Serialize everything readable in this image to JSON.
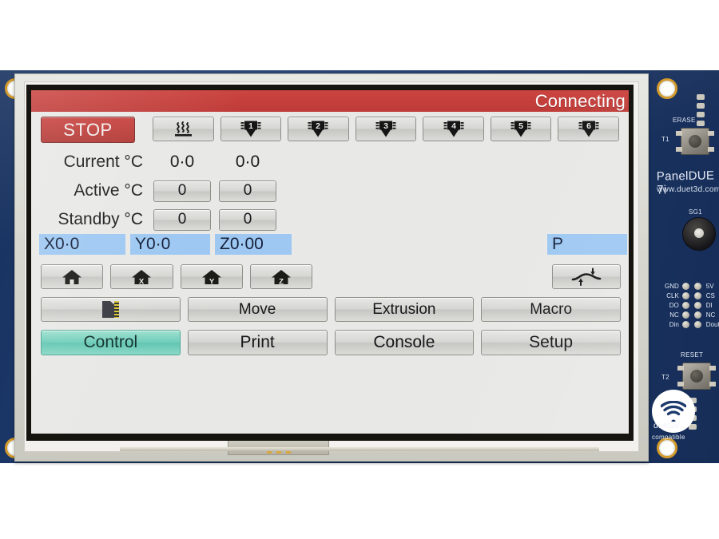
{
  "device": {
    "name": "PanelDUE 7i",
    "vendor_url": "www.duet3d.com",
    "badge_text_1": "duet3d",
    "badge_text_2": "compatible"
  },
  "pcb": {
    "erase_label": "ERASE",
    "erase_ref": "T1",
    "reset_label": "RESET",
    "reset_ref": "T2",
    "buzzer_ref": "SG1",
    "pins_left": [
      "GND",
      "CLK",
      "DO",
      "NC",
      "Din"
    ],
    "pins_right": [
      "5V",
      "CS",
      "DI",
      "NC",
      "Dout"
    ]
  },
  "screen": {
    "titlebar": {
      "status": "Connecting"
    },
    "stop_button": "STOP",
    "tools": [
      {
        "label": "",
        "icon": "heated-bed-icon",
        "number": ""
      },
      {
        "label": "",
        "icon": "tool-icon",
        "number": "1"
      },
      {
        "label": "",
        "icon": "tool-icon",
        "number": "2"
      },
      {
        "label": "",
        "icon": "tool-icon",
        "number": "3"
      },
      {
        "label": "",
        "icon": "tool-icon",
        "number": "4"
      },
      {
        "label": "",
        "icon": "tool-icon",
        "number": "5"
      },
      {
        "label": "",
        "icon": "tool-icon",
        "number": "6"
      }
    ],
    "temperatures": {
      "rows": [
        {
          "label": "Current °C",
          "type": "text",
          "values": [
            "0·0",
            "0·0"
          ]
        },
        {
          "label": "Active °C",
          "type": "button",
          "values": [
            "0",
            "0"
          ]
        },
        {
          "label": "Standby °C",
          "type": "button",
          "values": [
            "0",
            "0"
          ]
        }
      ]
    },
    "axes": [
      {
        "name": "X",
        "value": "X0·0"
      },
      {
        "name": "Y",
        "value": "Y0·0"
      },
      {
        "name": "Z",
        "value": "Z0·00"
      }
    ],
    "probe": {
      "value": "P"
    },
    "home_buttons": [
      {
        "name": "home-all",
        "axis": ""
      },
      {
        "name": "home-x",
        "axis": "X"
      },
      {
        "name": "home-y",
        "axis": "Y"
      },
      {
        "name": "home-z",
        "axis": "Z"
      }
    ],
    "bed_compensation_button": {
      "icon": "bed-compensation-icon"
    },
    "middle_row": [
      {
        "label": "",
        "icon": "sd-card-icon"
      },
      {
        "label": "Move",
        "icon": ""
      },
      {
        "label": "Extrusion",
        "icon": ""
      },
      {
        "label": "Macro",
        "icon": ""
      }
    ],
    "tabs": [
      {
        "label": "Control",
        "active": true
      },
      {
        "label": "Print",
        "active": false
      },
      {
        "label": "Console",
        "active": false
      },
      {
        "label": "Setup",
        "active": false
      }
    ],
    "colors": {
      "titlebar_red": "#c33a3a",
      "stop_red": "#bd3b38",
      "axis_highlight_blue": "#9ec8f2",
      "active_tab_teal": "#6fcdba",
      "screen_background": "#e8e8e6",
      "pcb_blue": "#1b3768"
    }
  }
}
